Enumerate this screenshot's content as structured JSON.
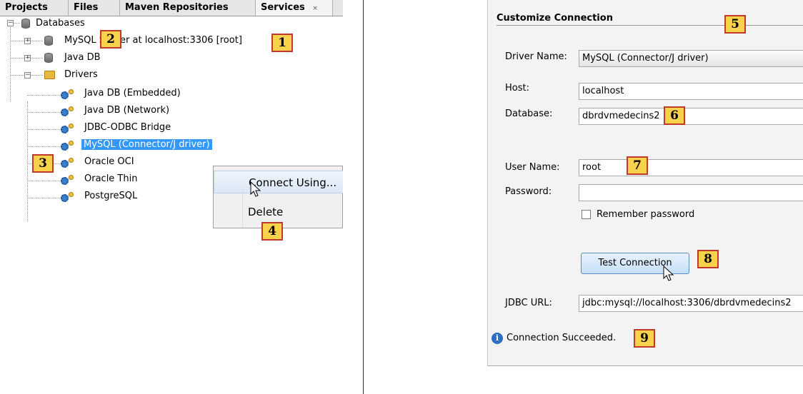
{
  "services_window": {
    "tabs": [
      {
        "label": "Projects"
      },
      {
        "label": "Files"
      },
      {
        "label": "Maven Repositories"
      },
      {
        "label": "Services",
        "close": "×"
      }
    ],
    "tree": {
      "databases": "Databases",
      "mysql_server": "MySQL Server at localhost:3306 [root]",
      "java_db": "Java DB",
      "drivers": "Drivers",
      "driver_items": [
        "Java DB (Embedded)",
        "Java DB (Network)",
        "JDBC-ODBC Bridge",
        "MySQL (Connector/J driver)",
        "Oracle OCI",
        "Oracle Thin",
        "PostgreSQL"
      ]
    },
    "context_menu": {
      "connect_using": "Connect Using...",
      "delete": "Delete"
    }
  },
  "customize_connection": {
    "title": "Customize Connection",
    "driver_name_label": "Driver Name:",
    "driver_name_value": "MySQL (Connector/J driver)",
    "host_label": "Host:",
    "host_value": "localhost",
    "database_label": "Database:",
    "database_value": "dbrdvmedecins2",
    "username_label": "User Name:",
    "username_value": "root",
    "password_label": "Password:",
    "password_value": "",
    "remember_password": "Remember password",
    "test_connection": "Test Connection",
    "jdbc_url_label": "JDBC URL:",
    "jdbc_url_value": "jdbc:mysql://localhost:3306/dbrdvmedecins2",
    "status": "Connection Succeeded."
  },
  "badges": [
    "1",
    "2",
    "3",
    "4",
    "5",
    "6",
    "7",
    "8",
    "9"
  ],
  "colors": {
    "selection": "#3399ff",
    "badge_fill": "#f8d24a",
    "badge_border": "#c0392b",
    "button": "#c6dff7"
  }
}
